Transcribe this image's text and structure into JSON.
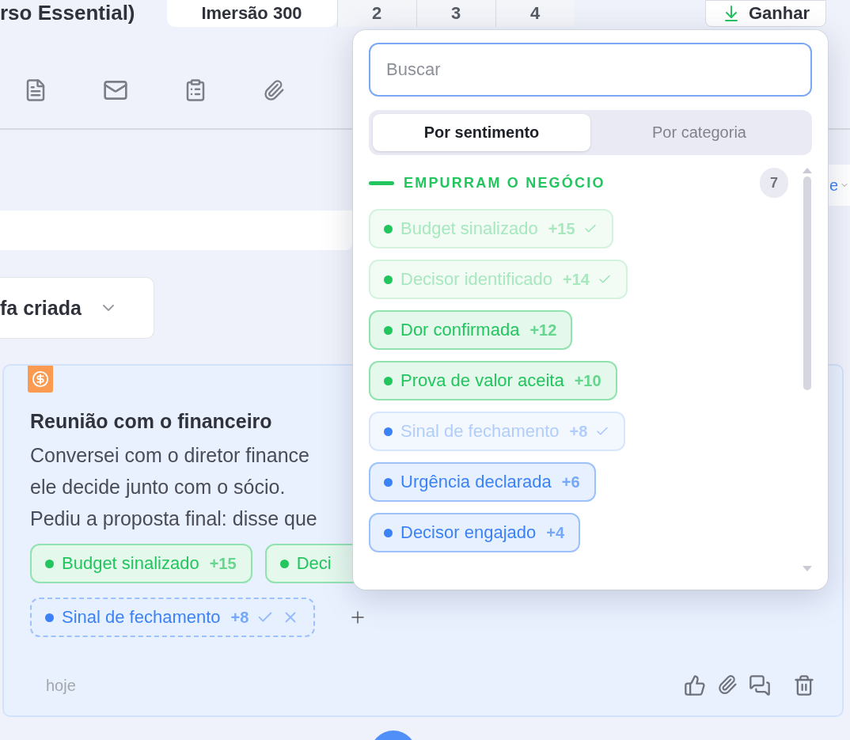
{
  "header": {
    "title": "rso Essential)",
    "steps": [
      {
        "label": "Imersão 300",
        "selected": true
      },
      {
        "label": "2",
        "selected": false
      },
      {
        "label": "3",
        "selected": false
      },
      {
        "label": "4",
        "selected": false
      }
    ],
    "win_button": "Ganhar"
  },
  "side_control": {
    "label": "e"
  },
  "stage_select": {
    "value": "fa criada"
  },
  "note": {
    "title": "Reunião com o financeiro",
    "lines": [
      "Conversei com o diretor finance",
      "ele decide junto com o sócio.",
      "Pediu a proposta final: disse que"
    ],
    "tags": [
      {
        "label": "Budget sinalizado",
        "points": "+15",
        "color": "#22c55e",
        "kind": "confirmed"
      },
      {
        "label": "Deci",
        "color": "#22c55e",
        "kind": "confirmed"
      },
      {
        "label": "Sinal de fechamento",
        "points": "+8",
        "color": "#3b82f6",
        "kind": "suggested"
      }
    ],
    "date": "hoje"
  },
  "picker": {
    "search": {
      "placeholder": "Buscar"
    },
    "modes": [
      {
        "label": "Por sentimento",
        "selected": true
      },
      {
        "label": "Por categoria",
        "selected": false
      }
    ],
    "section": {
      "title": "EMPURRAM O NEGÓCIO",
      "count": "7",
      "color": "#22c55e"
    },
    "tags": [
      {
        "label": "Budget sinalizado",
        "points": "+15",
        "color": "#22c55e",
        "applied": true
      },
      {
        "label": "Decisor identificado",
        "points": "+14",
        "color": "#22c55e",
        "applied": true
      },
      {
        "label": "Dor confirmada",
        "points": "+12",
        "color": "#22c55e",
        "applied": false
      },
      {
        "label": "Prova de valor aceita",
        "points": "+10",
        "color": "#22c55e",
        "applied": false
      },
      {
        "label": "Sinal de fechamento",
        "points": "+8",
        "color": "#3b82f6",
        "applied": true
      },
      {
        "label": "Urgência declarada",
        "points": "+6",
        "color": "#3b82f6",
        "applied": false
      },
      {
        "label": "Decisor engajado",
        "points": "+4",
        "color": "#3b82f6",
        "applied": false
      }
    ]
  }
}
